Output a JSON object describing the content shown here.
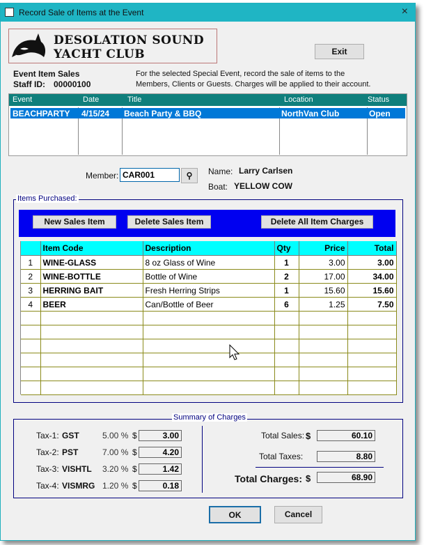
{
  "window": {
    "title": "Record Sale of Items at the Event",
    "close_icon": "×"
  },
  "logo": {
    "line1": "DESOLATION SOUND",
    "line2": "YACHT CLUB"
  },
  "exit_label": "Exit",
  "header": {
    "section": "Event Item Sales",
    "staff_label": "Staff ID:",
    "staff_id": "00000100",
    "instructions_1": "For the selected Special Event, record the sale of items to the",
    "instructions_2": "Members, Clients or Guests.  Charges will be applied to their account."
  },
  "events": {
    "columns": [
      "Event",
      "Date",
      "Title",
      "Location",
      "Status"
    ],
    "rows": [
      {
        "event": "BEACHPARTY",
        "date": "4/15/24",
        "title": "Beach Party & BBQ",
        "location": "NorthVan Club",
        "status": "Open"
      }
    ]
  },
  "member": {
    "label": "Member:",
    "value": "CAR001",
    "name_label": "Name:",
    "name": "Larry Carlsen",
    "boat_label": "Boat:",
    "boat": "YELLOW COW"
  },
  "items": {
    "group_title": "Items Purchased:",
    "buttons": {
      "new": "New Sales Item",
      "delete": "Delete Sales Item",
      "delete_all": "Delete All Item Charges"
    },
    "columns": [
      "",
      "Item Code",
      "Description",
      "Qty",
      "Price",
      "Total"
    ],
    "rows": [
      {
        "n": "1",
        "code": "WINE-GLASS",
        "desc": "8 oz Glass of Wine",
        "qty": "1",
        "price": "3.00",
        "total": "3.00"
      },
      {
        "n": "2",
        "code": "WINE-BOTTLE",
        "desc": "Bottle of Wine",
        "qty": "2",
        "price": "17.00",
        "total": "34.00"
      },
      {
        "n": "3",
        "code": "HERRING BAIT",
        "desc": "Fresh Herring Strips",
        "qty": "1",
        "price": "15.60",
        "total": "15.60"
      },
      {
        "n": "4",
        "code": "BEER",
        "desc": "Can/Bottle of Beer",
        "qty": "6",
        "price": "1.25",
        "total": "7.50"
      }
    ]
  },
  "summary": {
    "title": "Summary of Charges",
    "taxes": [
      {
        "label": "Tax-1:",
        "code": "GST",
        "rate": "5.00 %",
        "cur": "$",
        "amount": "3.00"
      },
      {
        "label": "Tax-2:",
        "code": "PST",
        "rate": "7.00 %",
        "cur": "$",
        "amount": "4.20"
      },
      {
        "label": "Tax-3:",
        "code": "VISHTL",
        "rate": "3.20 %",
        "cur": "$",
        "amount": "1.42"
      },
      {
        "label": "Tax-4:",
        "code": "VISMRG",
        "rate": "1.20 %",
        "cur": "$",
        "amount": "0.18"
      }
    ],
    "total_sales_label": "Total Sales:",
    "total_sales": "60.10",
    "total_taxes_label": "Total Taxes:",
    "total_taxes": "8.80",
    "total_charges_label": "Total Charges:",
    "total_charges": "68.90",
    "cur": "$"
  },
  "footer": {
    "ok": "OK",
    "cancel": "Cancel"
  }
}
